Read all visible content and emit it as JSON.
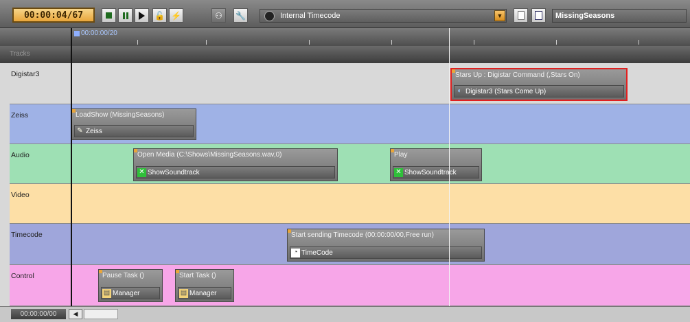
{
  "toolbar": {
    "timecode": "00:00:04/67",
    "timecode_source": "Internal Timecode",
    "show_name": "MissingSeasons"
  },
  "ruler": {
    "position_label": "00:00:00/20"
  },
  "tracks_header": "Tracks",
  "tracks": [
    {
      "name": "Digistar3",
      "color": "#d9d9d9"
    },
    {
      "name": "Zeiss",
      "color": "#9fb2e6"
    },
    {
      "name": "Audio",
      "color": "#9ee0b4"
    },
    {
      "name": "Video",
      "color": "#fddfa6"
    },
    {
      "name": "Timecode",
      "color": "#9fa6db"
    },
    {
      "name": "Control",
      "color": "#f7a6e8"
    }
  ],
  "cues": [
    {
      "title": "Stars Up : Digistar Command (,Stars On)",
      "device": "Digistar3 (Stars Come Up)",
      "icon": "digistar-icon"
    },
    {
      "title": "LoadShow (MissingSeasons)",
      "device": "Zeiss",
      "icon": "zeiss-icon"
    },
    {
      "title": "Open Media (C:\\Shows\\MissingSeasons.wav,0)",
      "device": "ShowSoundtrack",
      "icon": "soundtrack-icon"
    },
    {
      "title": "Play",
      "device": "ShowSoundtrack",
      "icon": "soundtrack-icon"
    },
    {
      "title": "Start sending Timecode (00:00:00/00,Free run)",
      "device": "TimeCode",
      "icon": "timecode-icon"
    },
    {
      "title": "Pause Task ()",
      "device": "Manager",
      "icon": "manager-icon"
    },
    {
      "title": "Start Task ()",
      "device": "Manager",
      "icon": "manager-icon"
    }
  ],
  "footer": {
    "timecode": "00:00:00/00"
  }
}
